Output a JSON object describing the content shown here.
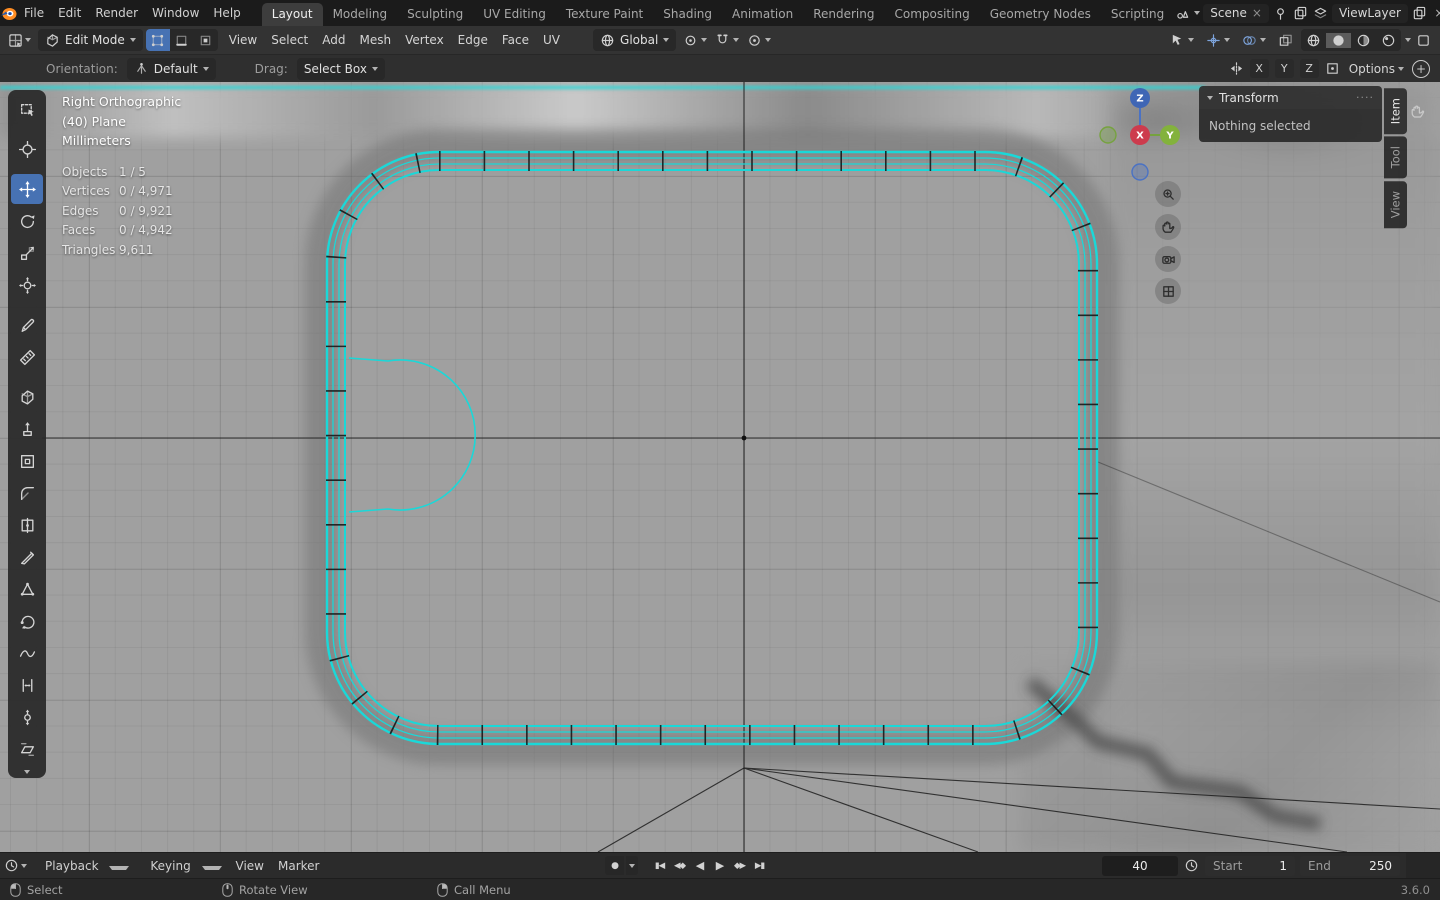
{
  "colors": {
    "accent": "#4772b3",
    "edge_select": "#1ad8d8",
    "viewport_bg": "#a0a0a0"
  },
  "icons": {
    "close": "×",
    "grip": "····",
    "record": "●",
    "plus": "+",
    "transport": [
      "▮◀",
      "◀◆",
      "◀",
      "▶",
      "◆▶",
      "▶▮"
    ]
  },
  "topbar": {
    "menus": [
      "File",
      "Edit",
      "Render",
      "Window",
      "Help"
    ],
    "workspaces": [
      "Layout",
      "Modeling",
      "Sculpting",
      "UV Editing",
      "Texture Paint",
      "Shading",
      "Animation",
      "Rendering",
      "Compositing",
      "Geometry Nodes",
      "Scripting"
    ],
    "scene_label": "Scene",
    "viewlayer_label": "ViewLayer"
  },
  "modebar": {
    "mode": "Edit Mode",
    "menus": [
      "View",
      "Select",
      "Add",
      "Mesh",
      "Vertex",
      "Edge",
      "Face",
      "UV"
    ],
    "orientation": "Global"
  },
  "toolheader": {
    "orientation_label": "Orientation:",
    "orientation_value": "Default",
    "drag_label": "Drag:",
    "drag_value": "Select Box",
    "axes": [
      "X",
      "Y",
      "Z"
    ],
    "options": "Options"
  },
  "tools": [
    "select-box",
    "cursor",
    "move",
    "rotate",
    "scale",
    "transform",
    "annotate",
    "measure",
    "add-cube",
    "extrude-region",
    "inset-faces",
    "bevel",
    "loop-cut",
    "knife",
    "poly-build",
    "spin",
    "smooth",
    "edge-slide",
    "shrink-fatten",
    "shear"
  ],
  "active_tool": "move",
  "overlay": {
    "view": "Right Orthographic",
    "object": "(40) Plane",
    "units": "Millimeters",
    "stats": [
      {
        "label": "Objects",
        "value": "1 / 5"
      },
      {
        "label": "Vertices",
        "value": "0 / 4,971"
      },
      {
        "label": "Edges",
        "value": "0 / 9,921"
      },
      {
        "label": "Faces",
        "value": "0 / 4,942"
      },
      {
        "label": "Triangles",
        "value": "9,611"
      }
    ]
  },
  "npanel": {
    "title": "Transform",
    "body": "Nothing selected",
    "tabs": [
      "Item",
      "Tool",
      "View"
    ]
  },
  "gizmo": {
    "x": "X",
    "y": "Y",
    "z": "Z"
  },
  "timeline": {
    "menus": [
      "Playback",
      "Keying",
      "View",
      "Marker"
    ],
    "frame": "40",
    "start_label": "Start",
    "start_value": "1",
    "end_label": "End",
    "end_value": "250"
  },
  "statusbar": {
    "select": "Select",
    "rotate": "Rotate View",
    "call_menu": "Call Menu",
    "version": "3.6.0"
  }
}
